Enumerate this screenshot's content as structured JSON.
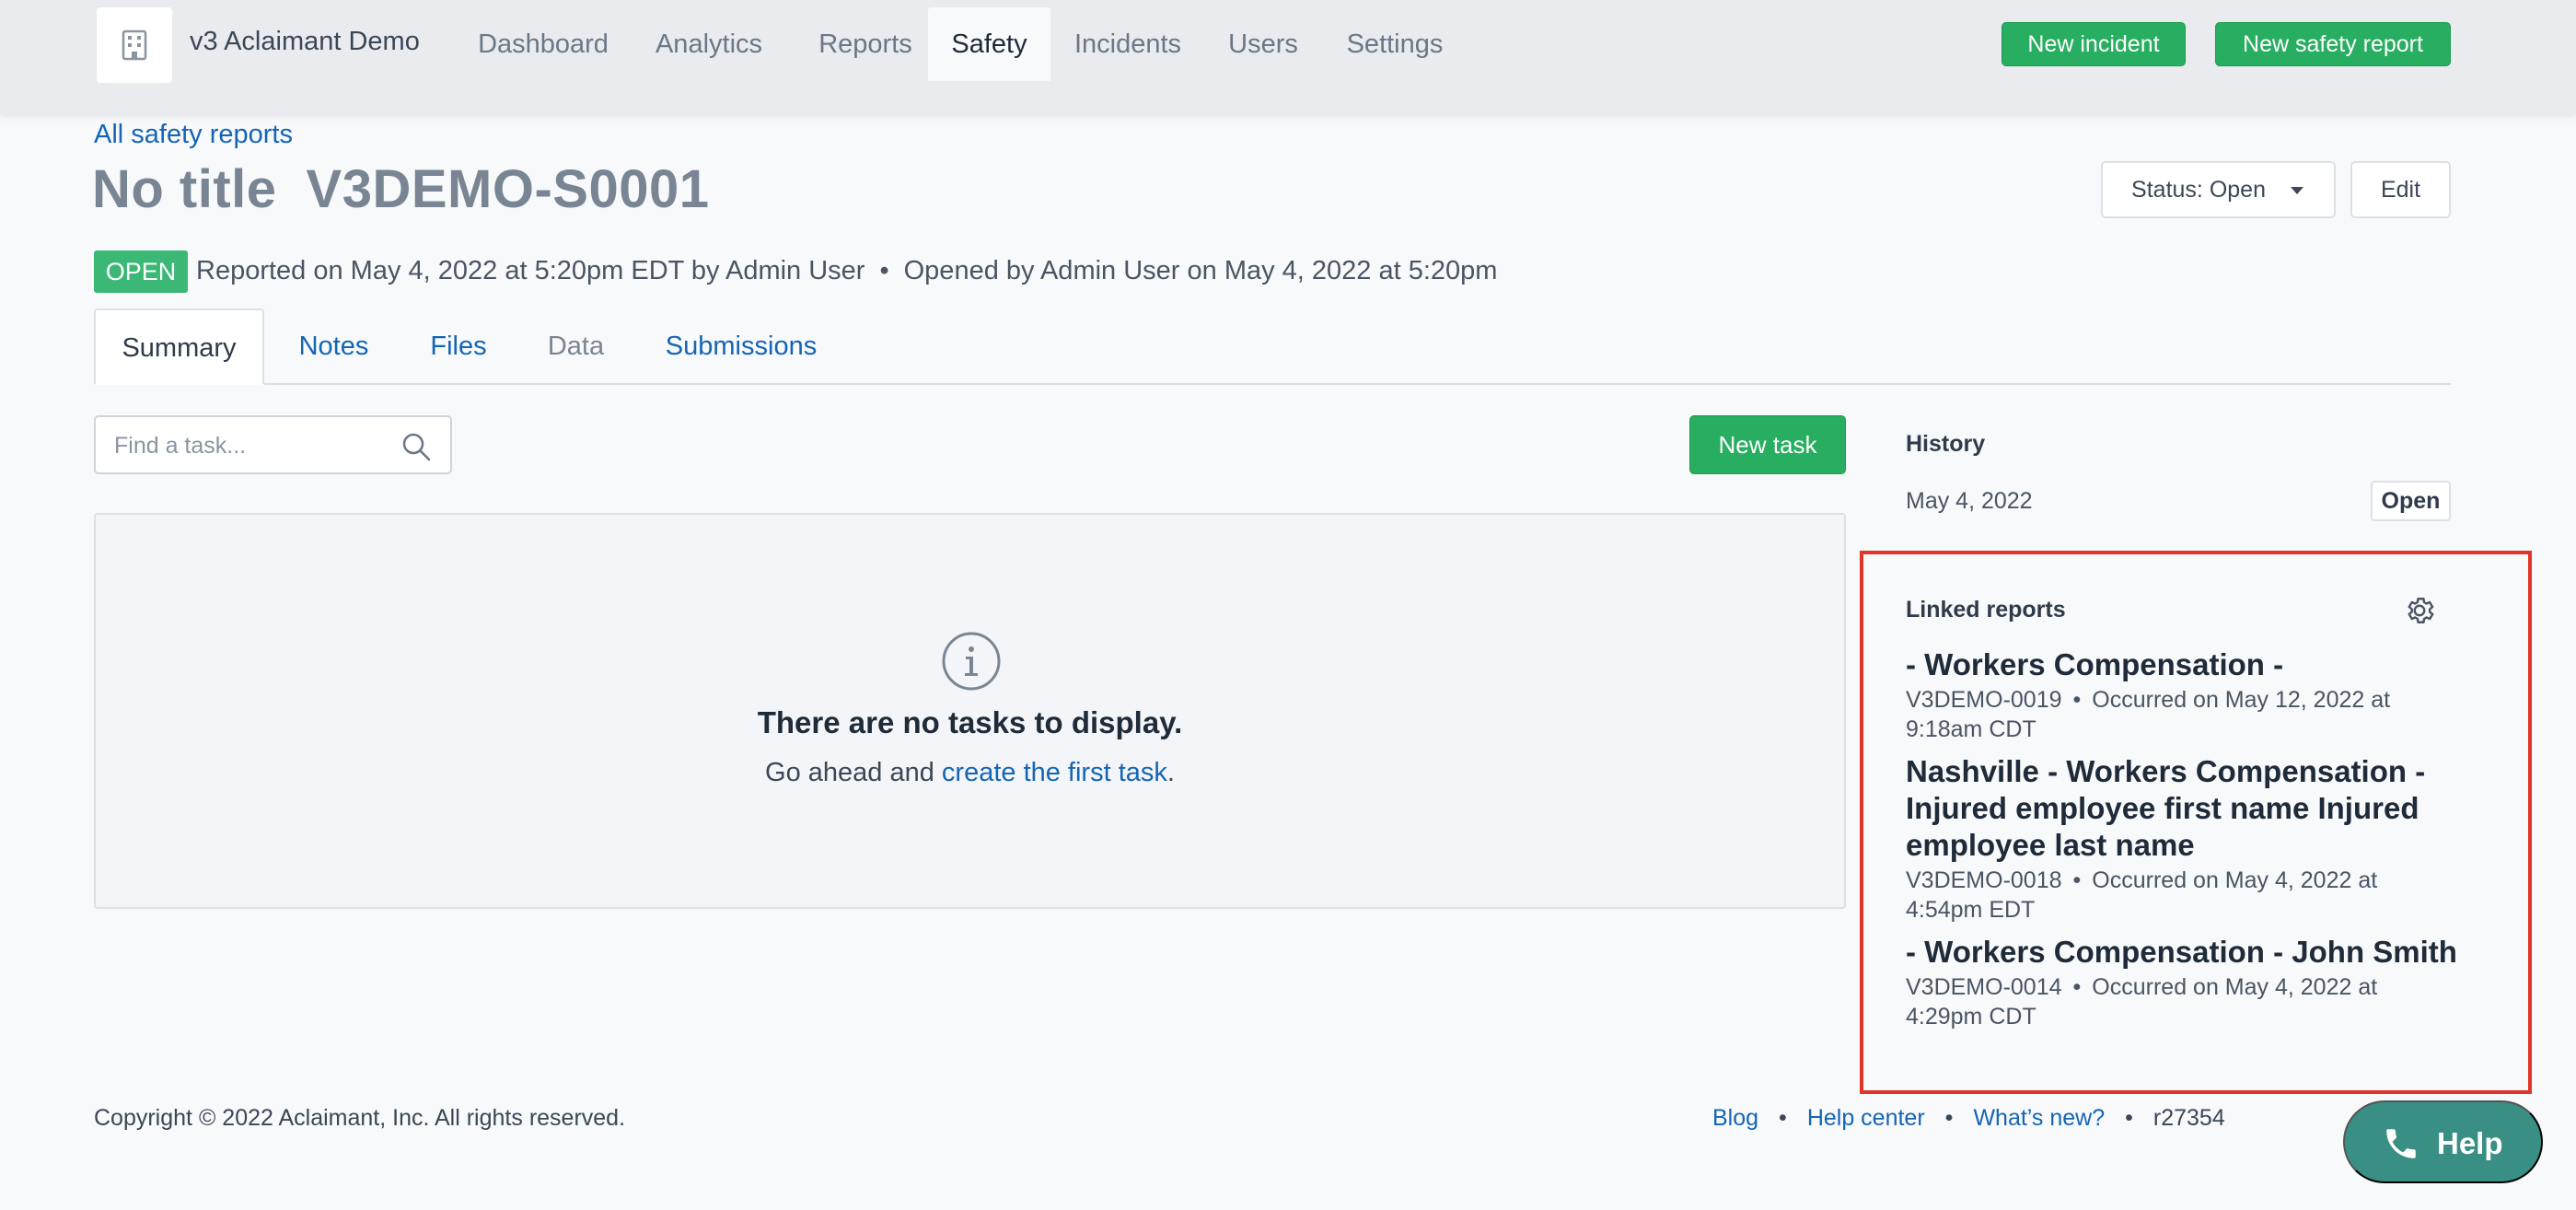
{
  "app": {
    "name": "v3 Aclaimant Demo",
    "logo_icon": "building-icon"
  },
  "nav": {
    "items": [
      {
        "label": "Dashboard",
        "active": false
      },
      {
        "label": "Analytics",
        "active": false
      },
      {
        "label": "Reports",
        "active": false
      },
      {
        "label": "Safety",
        "active": true
      },
      {
        "label": "Incidents",
        "active": false
      },
      {
        "label": "Users",
        "active": false
      },
      {
        "label": "Settings",
        "active": false
      }
    ],
    "new_incident": "New incident",
    "new_safety_report": "New safety report"
  },
  "header": {
    "back_link": "All safety reports",
    "title": "No title",
    "report_id": "V3DEMO-S0001",
    "status_dropdown": "Status: Open",
    "edit": "Edit",
    "status_badge": "OPEN",
    "reported": "Reported on May 4, 2022 at 5:20pm EDT by Admin User",
    "opened": "Opened by Admin User on May 4, 2022 at 5:20pm",
    "dot": "•"
  },
  "tabs": [
    {
      "label": "Summary",
      "state": "active"
    },
    {
      "label": "Notes",
      "state": "link"
    },
    {
      "label": "Files",
      "state": "link"
    },
    {
      "label": "Data",
      "state": "muted"
    },
    {
      "label": "Submissions",
      "state": "link"
    }
  ],
  "tasks": {
    "search_placeholder": "Find a task...",
    "new_task": "New task",
    "empty_title": "There are no tasks to display.",
    "empty_prefix": "Go ahead and ",
    "empty_link": "create the first task",
    "empty_suffix": "."
  },
  "history": {
    "heading": "History",
    "date": "May 4, 2022",
    "status": "Open"
  },
  "linked_reports": {
    "heading": "Linked reports",
    "items": [
      {
        "title": "- Workers Compensation -",
        "id": "V3DEMO-0019",
        "occurred_line1": "Occurred on May 12, 2022 at",
        "occurred_line2": "9:18am CDT"
      },
      {
        "title": "Nashville - Workers Compensation - Injured employee first name Injured employee last name",
        "id": "V3DEMO-0018",
        "occurred_line1": "Occurred on May 4, 2022 at",
        "occurred_line2": "4:54pm EDT"
      },
      {
        "title": "- Workers Compensation - John Smith",
        "id": "V3DEMO-0014",
        "occurred_line1": "Occurred on May 4, 2022 at",
        "occurred_line2": "4:29pm CDT"
      }
    ]
  },
  "footer": {
    "copyright": "Copyright © 2022 Aclaimant, Inc. All rights reserved.",
    "links": [
      "Blog",
      "Help center",
      "What’s new?"
    ],
    "revision": "r27354",
    "help": "Help"
  },
  "colors": {
    "accent_green": "#27ae60",
    "link_blue": "#1565b5",
    "highlight_red": "#e0352b",
    "help_teal": "#3a8f85"
  }
}
